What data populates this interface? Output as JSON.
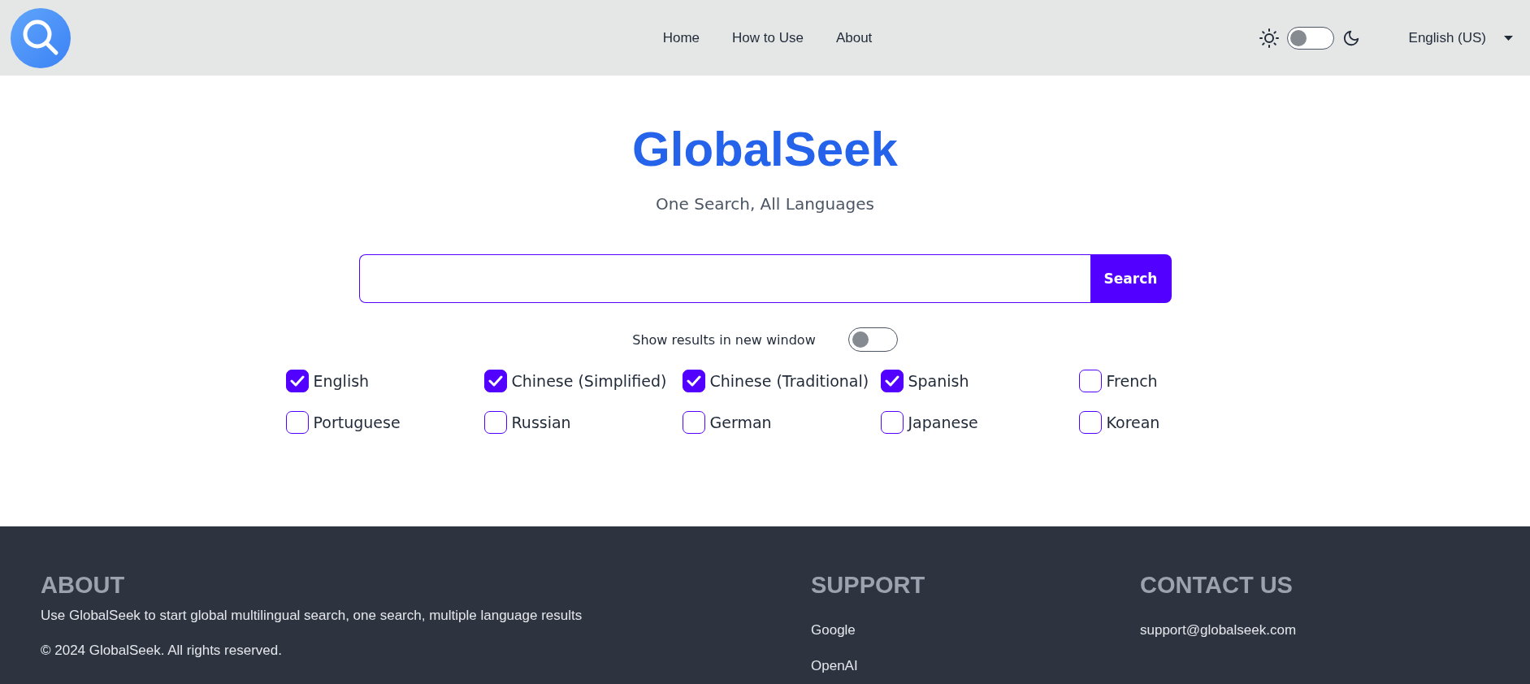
{
  "header": {
    "nav": [
      {
        "label": "Home"
      },
      {
        "label": "How to Use"
      },
      {
        "label": "About"
      }
    ],
    "theme_toggle": {
      "on": false
    },
    "language_select": {
      "value": "English (US)"
    }
  },
  "hero": {
    "title": "GlobalSeek",
    "subtitle": "One Search, All Languages"
  },
  "search": {
    "button": "Search"
  },
  "new_window": {
    "label": "Show results in new window",
    "on": false
  },
  "languages": [
    {
      "label": "English",
      "checked": true
    },
    {
      "label": "Chinese (Simplified)",
      "checked": true
    },
    {
      "label": "Chinese (Traditional)",
      "checked": true
    },
    {
      "label": "Spanish",
      "checked": true
    },
    {
      "label": "French",
      "checked": false
    },
    {
      "label": "Portuguese",
      "checked": false
    },
    {
      "label": "Russian",
      "checked": false
    },
    {
      "label": "German",
      "checked": false
    },
    {
      "label": "Japanese",
      "checked": false
    },
    {
      "label": "Korean",
      "checked": false
    }
  ],
  "footer": {
    "about": {
      "heading": "ABOUT",
      "text": "Use GlobalSeek to start global multilingual search, one search, multiple language results",
      "copyright": "© 2024 GlobalSeek. All rights reserved."
    },
    "support": {
      "heading": "SUPPORT",
      "links": [
        "Google",
        "OpenAI"
      ]
    },
    "contact": {
      "heading": "CONTACT US",
      "email": "support@globalseek.com"
    }
  }
}
